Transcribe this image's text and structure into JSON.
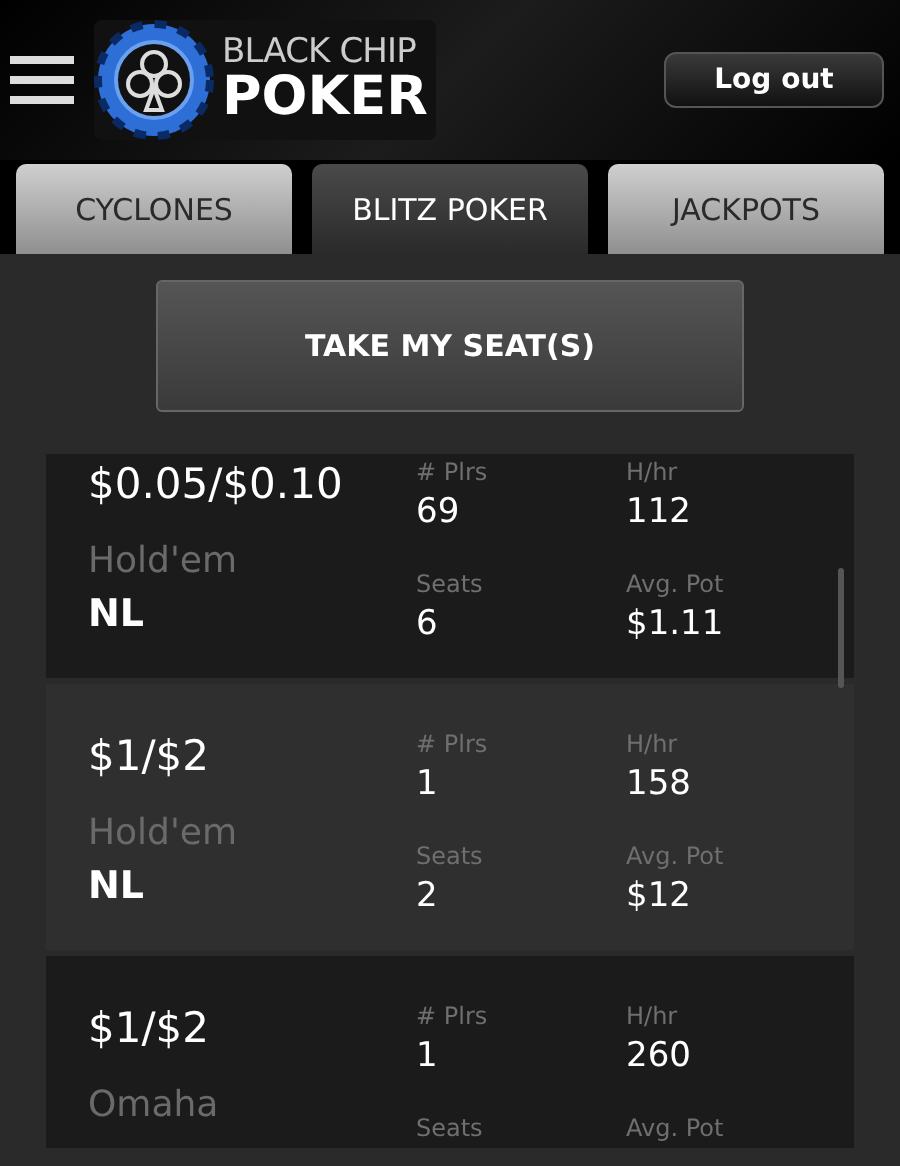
{
  "header": {
    "logo": {
      "line1": "BLACK CHIP",
      "line2": "POKER"
    },
    "logout": "Log out"
  },
  "tabs": [
    {
      "label": "CYCLONES",
      "selected": false
    },
    {
      "label": "BLITZ POKER",
      "selected": true
    },
    {
      "label": "JACKPOTS",
      "selected": false
    }
  ],
  "take_seat": "TAKE MY SEAT(S)",
  "tables": [
    {
      "stakes": "$0.05/$0.10",
      "game": "Hold'em",
      "limit": "NL",
      "selected": false,
      "stats": [
        {
          "label": "# Plrs",
          "value": "69"
        },
        {
          "label": "H/hr",
          "value": "112"
        },
        {
          "label": "Seats",
          "value": "6"
        },
        {
          "label": "Avg. Pot",
          "value": "$1.11"
        }
      ]
    },
    {
      "stakes": "$1/$2",
      "game": "Hold'em",
      "limit": "NL",
      "selected": true,
      "stats": [
        {
          "label": "# Plrs",
          "value": "1"
        },
        {
          "label": "H/hr",
          "value": "158"
        },
        {
          "label": "Seats",
          "value": "2"
        },
        {
          "label": "Avg. Pot",
          "value": "$12"
        }
      ]
    },
    {
      "stakes": "$1/$2",
      "game": "Omaha",
      "selected": false,
      "stats": [
        {
          "label": "# Plrs",
          "value": "1"
        },
        {
          "label": "H/hr",
          "value": "260"
        },
        {
          "label": "Seats"
        },
        {
          "label": "Avg. Pot"
        }
      ]
    }
  ]
}
